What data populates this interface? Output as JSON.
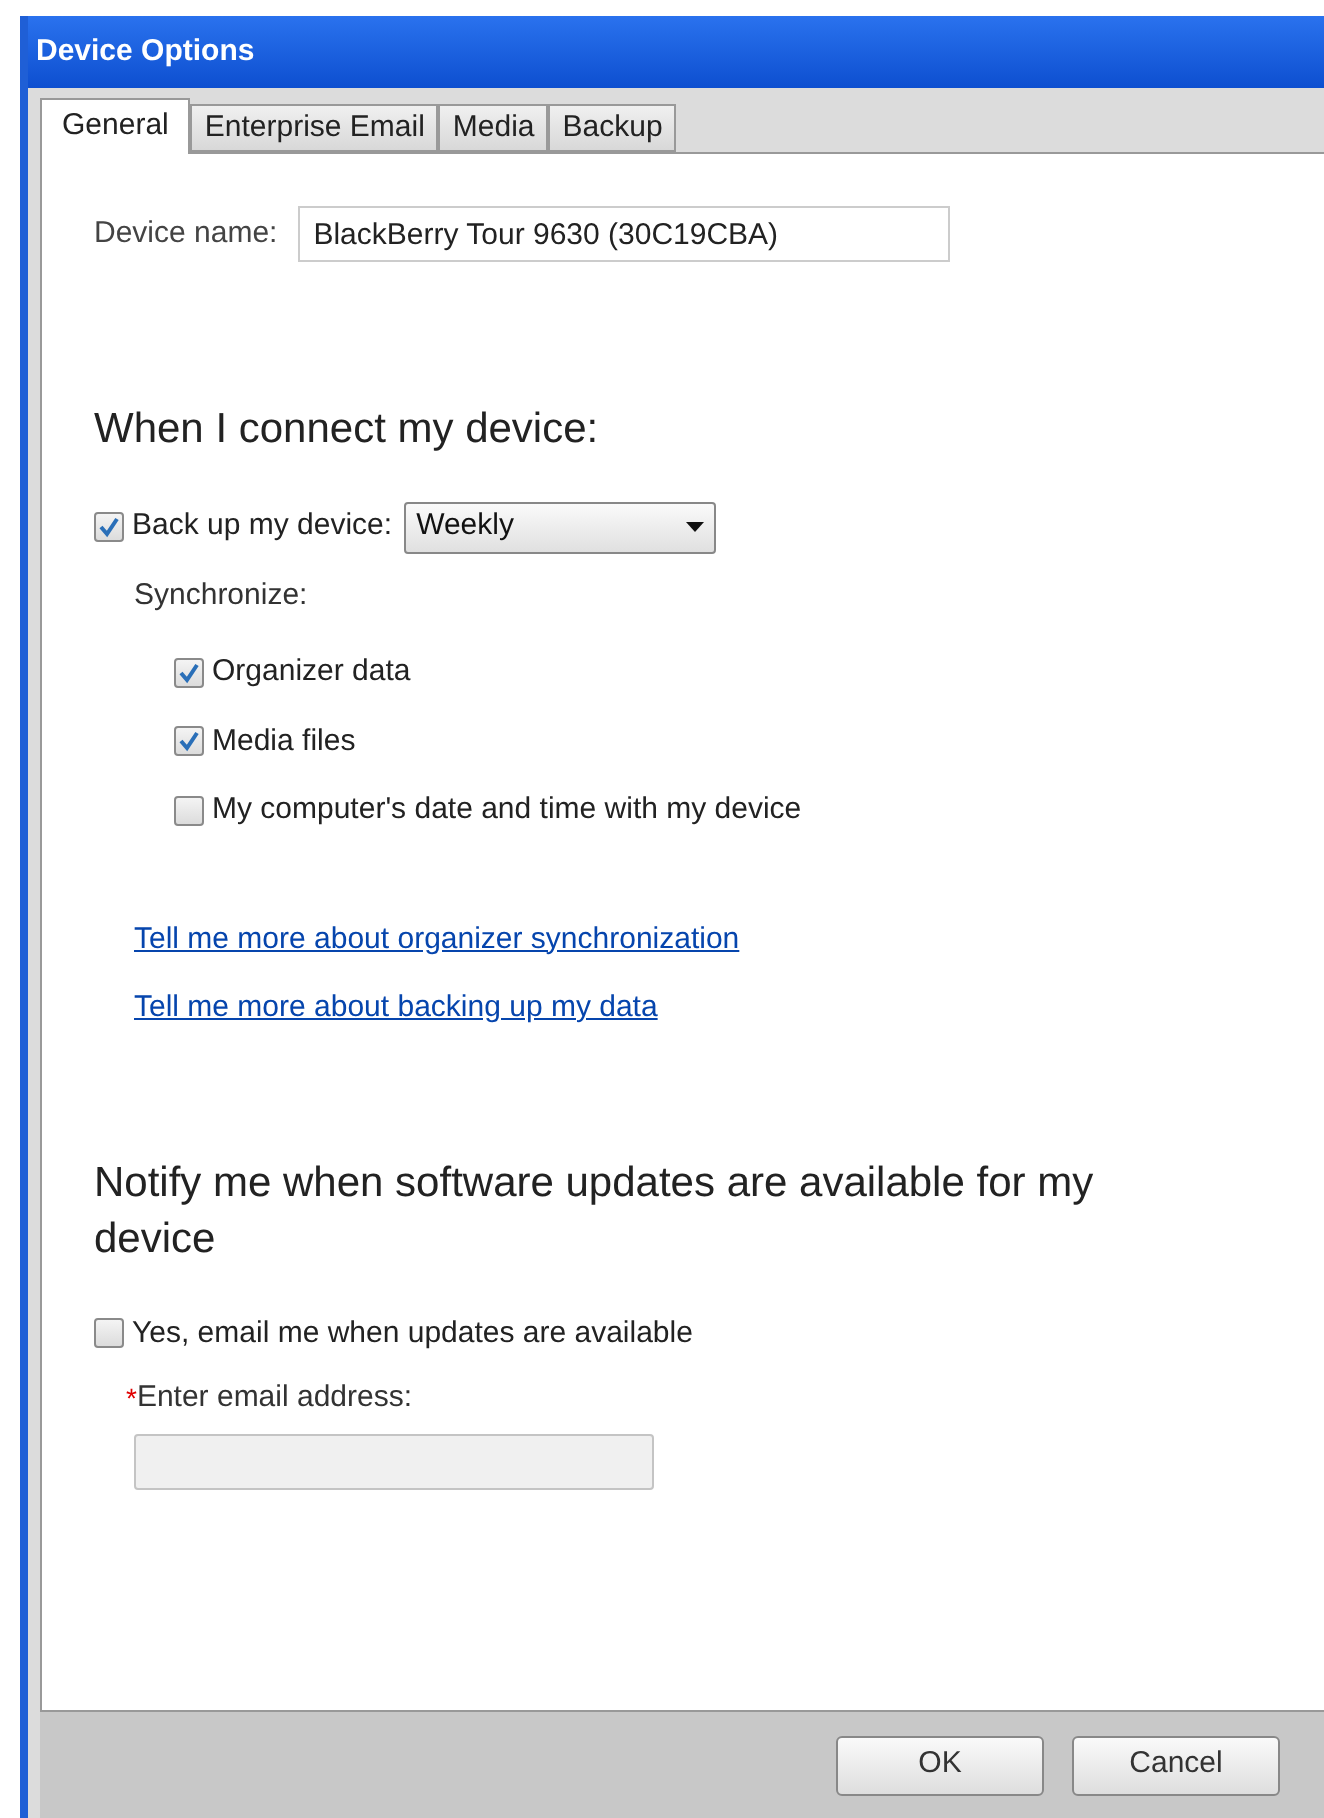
{
  "window": {
    "title": "Device Options"
  },
  "tabs": [
    {
      "label": "General",
      "selected": true
    },
    {
      "label": "Enterprise Email",
      "selected": false
    },
    {
      "label": "Media",
      "selected": false
    },
    {
      "label": "Backup",
      "selected": false
    }
  ],
  "device_name": {
    "label": "Device name:",
    "value": "BlackBerry Tour 9630 (30C19CBA)"
  },
  "connect": {
    "heading": "When I connect my device:",
    "backup": {
      "label": "Back up my device:",
      "checked": true,
      "frequency": "Weekly"
    },
    "sync_label": "Synchronize:",
    "sync_items": [
      {
        "label": "Organizer data",
        "checked": true
      },
      {
        "label": "Media files",
        "checked": true
      },
      {
        "label": "My computer's date and time with my device",
        "checked": false
      }
    ],
    "links": [
      "Tell me more about organizer synchronization",
      "Tell me more about backing up my data"
    ]
  },
  "updates": {
    "heading": "Notify me when software updates are available for my device",
    "email_opt": {
      "label": "Yes, email me when updates are available",
      "checked": false
    },
    "required_mark": "*",
    "email_label": "Enter email address:",
    "email_disabled": true
  },
  "buttons": [
    "OK",
    "Cancel"
  ]
}
